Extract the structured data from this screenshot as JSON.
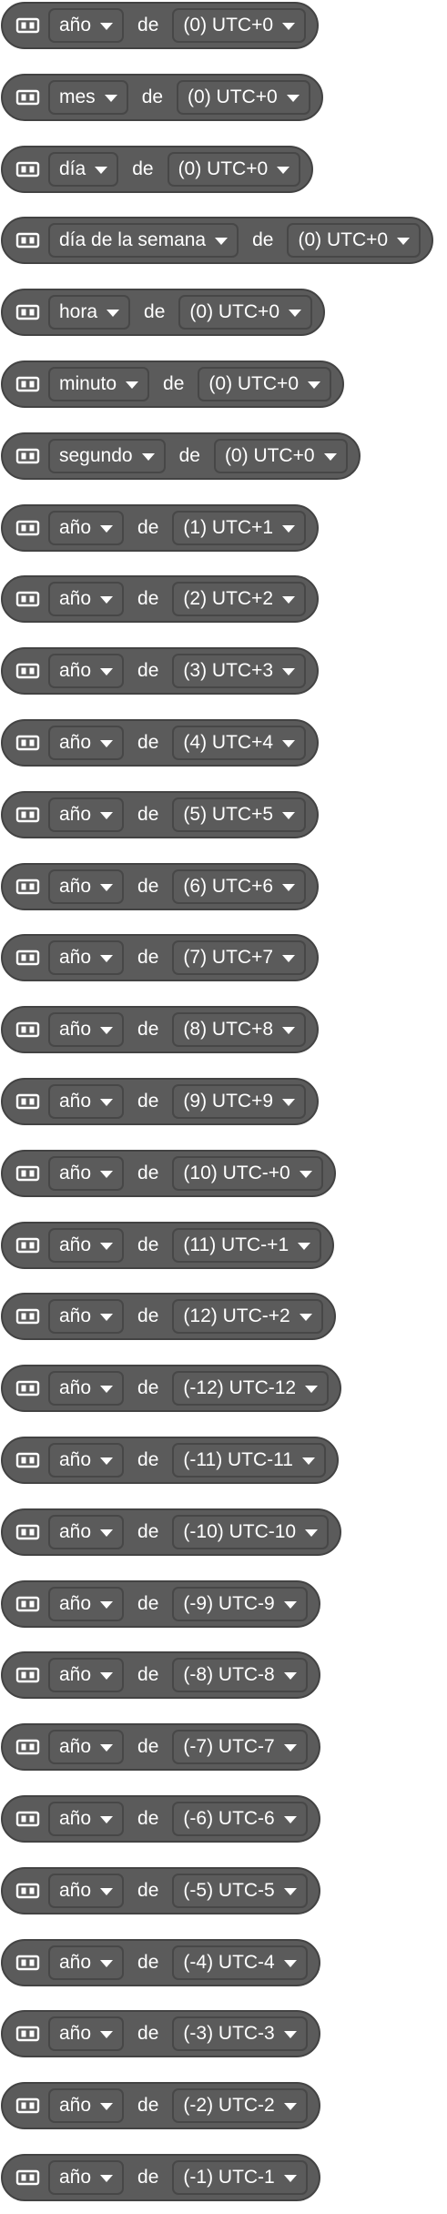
{
  "colors": {
    "block_fill": "#5b5b5b",
    "block_border": "#434343",
    "text": "#ffffff",
    "background": "#ffffff"
  },
  "icon": "sensor-chip-icon",
  "rows": [
    {
      "unit": "año",
      "connector": "de",
      "timezone": "(0) UTC+0"
    },
    {
      "unit": "mes",
      "connector": "de",
      "timezone": "(0) UTC+0"
    },
    {
      "unit": "día",
      "connector": "de",
      "timezone": "(0) UTC+0"
    },
    {
      "unit": "día de la semana",
      "connector": "de",
      "timezone": "(0) UTC+0"
    },
    {
      "unit": "hora",
      "connector": "de",
      "timezone": "(0) UTC+0"
    },
    {
      "unit": "minuto",
      "connector": "de",
      "timezone": "(0) UTC+0"
    },
    {
      "unit": "segundo",
      "connector": "de",
      "timezone": "(0) UTC+0"
    },
    {
      "unit": "año",
      "connector": "de",
      "timezone": "(1) UTC+1"
    },
    {
      "unit": "año",
      "connector": "de",
      "timezone": "(2) UTC+2"
    },
    {
      "unit": "año",
      "connector": "de",
      "timezone": "(3) UTC+3"
    },
    {
      "unit": "año",
      "connector": "de",
      "timezone": "(4) UTC+4"
    },
    {
      "unit": "año",
      "connector": "de",
      "timezone": "(5) UTC+5"
    },
    {
      "unit": "año",
      "connector": "de",
      "timezone": "(6) UTC+6"
    },
    {
      "unit": "año",
      "connector": "de",
      "timezone": "(7) UTC+7"
    },
    {
      "unit": "año",
      "connector": "de",
      "timezone": "(8) UTC+8"
    },
    {
      "unit": "año",
      "connector": "de",
      "timezone": "(9) UTC+9"
    },
    {
      "unit": "año",
      "connector": "de",
      "timezone": "(10) UTC-+0"
    },
    {
      "unit": "año",
      "connector": "de",
      "timezone": "(11) UTC-+1"
    },
    {
      "unit": "año",
      "connector": "de",
      "timezone": "(12) UTC-+2"
    },
    {
      "unit": "año",
      "connector": "de",
      "timezone": "(-12) UTC-12"
    },
    {
      "unit": "año",
      "connector": "de",
      "timezone": "(-11) UTC-11"
    },
    {
      "unit": "año",
      "connector": "de",
      "timezone": "(-10) UTC-10"
    },
    {
      "unit": "año",
      "connector": "de",
      "timezone": "(-9) UTC-9"
    },
    {
      "unit": "año",
      "connector": "de",
      "timezone": "(-8) UTC-8"
    },
    {
      "unit": "año",
      "connector": "de",
      "timezone": "(-7) UTC-7"
    },
    {
      "unit": "año",
      "connector": "de",
      "timezone": "(-6) UTC-6"
    },
    {
      "unit": "año",
      "connector": "de",
      "timezone": "(-5) UTC-5"
    },
    {
      "unit": "año",
      "connector": "de",
      "timezone": "(-4) UTC-4"
    },
    {
      "unit": "año",
      "connector": "de",
      "timezone": "(-3) UTC-3"
    },
    {
      "unit": "año",
      "connector": "de",
      "timezone": "(-2) UTC-2"
    },
    {
      "unit": "año",
      "connector": "de",
      "timezone": "(-1) UTC-1"
    }
  ]
}
